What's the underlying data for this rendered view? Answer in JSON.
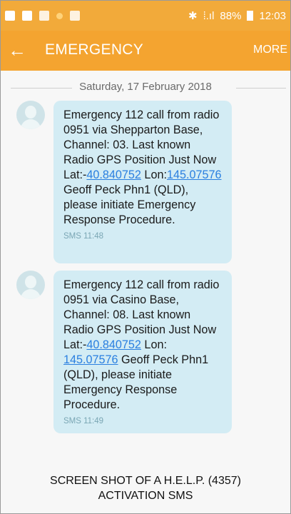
{
  "status_bar": {
    "battery": "88%",
    "time": "12:03"
  },
  "header": {
    "back_icon": "back-arrow-icon",
    "title": "EMERGENCY",
    "more_label": "MORE"
  },
  "date_separator": "Saturday, 17 February 2018",
  "messages": [
    {
      "prefix": "Emergency 112 call from radio 0951 via Shepparton Base, Channel: 03. Last known Radio GPS Position Just Now Lat:-",
      "lat": "40.840752",
      "mid": " Lon:",
      "lon": "145.07576",
      "suffix": "    Geoff Peck Phn1 (QLD), please initiate Emergency Response Procedure.",
      "meta": "SMS 11:48"
    },
    {
      "prefix": "Emergency 112 call from radio 0951 via Casino Base, Channel: 08. Last known Radio GPS Position Just Now Lat:-",
      "lat": "40.840752",
      "mid": " Lon: ",
      "lon": "145.07576",
      "suffix": "    Geoff Peck Phn1 (QLD), please initiate Emergency Response Procedure.",
      "meta": "SMS 11:49"
    }
  ],
  "caption": {
    "line1": "SCREEN SHOT OF A  H.E.L.P.  (4357)",
    "line2": "ACTIVATION SMS"
  }
}
